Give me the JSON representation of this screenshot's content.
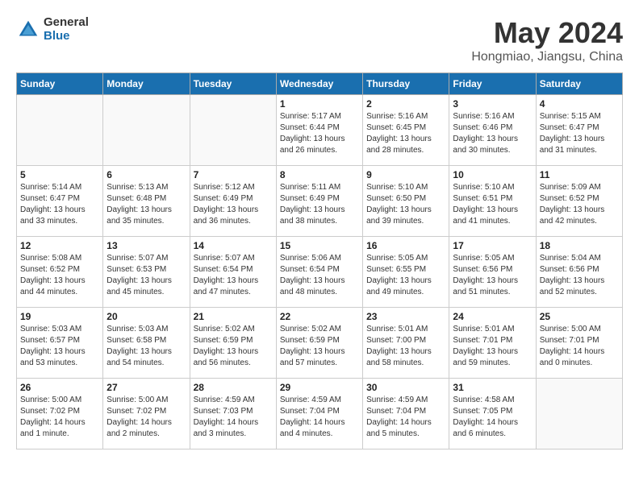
{
  "logo": {
    "general": "General",
    "blue": "Blue"
  },
  "title": "May 2024",
  "subtitle": "Hongmiao, Jiangsu, China",
  "days_header": [
    "Sunday",
    "Monday",
    "Tuesday",
    "Wednesday",
    "Thursday",
    "Friday",
    "Saturday"
  ],
  "weeks": [
    [
      {
        "day": "",
        "detail": ""
      },
      {
        "day": "",
        "detail": ""
      },
      {
        "day": "",
        "detail": ""
      },
      {
        "day": "1",
        "detail": "Sunrise: 5:17 AM\nSunset: 6:44 PM\nDaylight: 13 hours\nand 26 minutes."
      },
      {
        "day": "2",
        "detail": "Sunrise: 5:16 AM\nSunset: 6:45 PM\nDaylight: 13 hours\nand 28 minutes."
      },
      {
        "day": "3",
        "detail": "Sunrise: 5:16 AM\nSunset: 6:46 PM\nDaylight: 13 hours\nand 30 minutes."
      },
      {
        "day": "4",
        "detail": "Sunrise: 5:15 AM\nSunset: 6:47 PM\nDaylight: 13 hours\nand 31 minutes."
      }
    ],
    [
      {
        "day": "5",
        "detail": "Sunrise: 5:14 AM\nSunset: 6:47 PM\nDaylight: 13 hours\nand 33 minutes."
      },
      {
        "day": "6",
        "detail": "Sunrise: 5:13 AM\nSunset: 6:48 PM\nDaylight: 13 hours\nand 35 minutes."
      },
      {
        "day": "7",
        "detail": "Sunrise: 5:12 AM\nSunset: 6:49 PM\nDaylight: 13 hours\nand 36 minutes."
      },
      {
        "day": "8",
        "detail": "Sunrise: 5:11 AM\nSunset: 6:49 PM\nDaylight: 13 hours\nand 38 minutes."
      },
      {
        "day": "9",
        "detail": "Sunrise: 5:10 AM\nSunset: 6:50 PM\nDaylight: 13 hours\nand 39 minutes."
      },
      {
        "day": "10",
        "detail": "Sunrise: 5:10 AM\nSunset: 6:51 PM\nDaylight: 13 hours\nand 41 minutes."
      },
      {
        "day": "11",
        "detail": "Sunrise: 5:09 AM\nSunset: 6:52 PM\nDaylight: 13 hours\nand 42 minutes."
      }
    ],
    [
      {
        "day": "12",
        "detail": "Sunrise: 5:08 AM\nSunset: 6:52 PM\nDaylight: 13 hours\nand 44 minutes."
      },
      {
        "day": "13",
        "detail": "Sunrise: 5:07 AM\nSunset: 6:53 PM\nDaylight: 13 hours\nand 45 minutes."
      },
      {
        "day": "14",
        "detail": "Sunrise: 5:07 AM\nSunset: 6:54 PM\nDaylight: 13 hours\nand 47 minutes."
      },
      {
        "day": "15",
        "detail": "Sunrise: 5:06 AM\nSunset: 6:54 PM\nDaylight: 13 hours\nand 48 minutes."
      },
      {
        "day": "16",
        "detail": "Sunrise: 5:05 AM\nSunset: 6:55 PM\nDaylight: 13 hours\nand 49 minutes."
      },
      {
        "day": "17",
        "detail": "Sunrise: 5:05 AM\nSunset: 6:56 PM\nDaylight: 13 hours\nand 51 minutes."
      },
      {
        "day": "18",
        "detail": "Sunrise: 5:04 AM\nSunset: 6:56 PM\nDaylight: 13 hours\nand 52 minutes."
      }
    ],
    [
      {
        "day": "19",
        "detail": "Sunrise: 5:03 AM\nSunset: 6:57 PM\nDaylight: 13 hours\nand 53 minutes."
      },
      {
        "day": "20",
        "detail": "Sunrise: 5:03 AM\nSunset: 6:58 PM\nDaylight: 13 hours\nand 54 minutes."
      },
      {
        "day": "21",
        "detail": "Sunrise: 5:02 AM\nSunset: 6:59 PM\nDaylight: 13 hours\nand 56 minutes."
      },
      {
        "day": "22",
        "detail": "Sunrise: 5:02 AM\nSunset: 6:59 PM\nDaylight: 13 hours\nand 57 minutes."
      },
      {
        "day": "23",
        "detail": "Sunrise: 5:01 AM\nSunset: 7:00 PM\nDaylight: 13 hours\nand 58 minutes."
      },
      {
        "day": "24",
        "detail": "Sunrise: 5:01 AM\nSunset: 7:01 PM\nDaylight: 13 hours\nand 59 minutes."
      },
      {
        "day": "25",
        "detail": "Sunrise: 5:00 AM\nSunset: 7:01 PM\nDaylight: 14 hours\nand 0 minutes."
      }
    ],
    [
      {
        "day": "26",
        "detail": "Sunrise: 5:00 AM\nSunset: 7:02 PM\nDaylight: 14 hours\nand 1 minute."
      },
      {
        "day": "27",
        "detail": "Sunrise: 5:00 AM\nSunset: 7:02 PM\nDaylight: 14 hours\nand 2 minutes."
      },
      {
        "day": "28",
        "detail": "Sunrise: 4:59 AM\nSunset: 7:03 PM\nDaylight: 14 hours\nand 3 minutes."
      },
      {
        "day": "29",
        "detail": "Sunrise: 4:59 AM\nSunset: 7:04 PM\nDaylight: 14 hours\nand 4 minutes."
      },
      {
        "day": "30",
        "detail": "Sunrise: 4:59 AM\nSunset: 7:04 PM\nDaylight: 14 hours\nand 5 minutes."
      },
      {
        "day": "31",
        "detail": "Sunrise: 4:58 AM\nSunset: 7:05 PM\nDaylight: 14 hours\nand 6 minutes."
      },
      {
        "day": "",
        "detail": ""
      }
    ]
  ]
}
